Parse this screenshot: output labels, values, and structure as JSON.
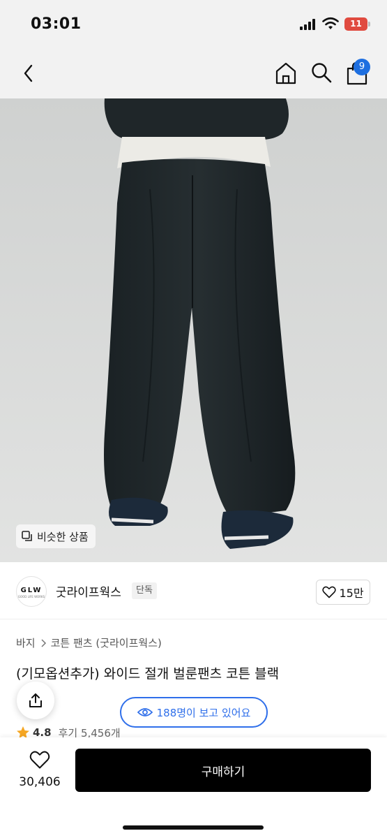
{
  "status_bar": {
    "time": "03:01",
    "battery": "11",
    "battery_color": "#e04a3f"
  },
  "nav": {
    "back_icon": "chevron-left-icon",
    "home_icon": "home-icon",
    "search_icon": "search-icon",
    "cart_icon": "shopping-bag-icon",
    "cart_count": "9",
    "badge_color": "#1e6fe0"
  },
  "hero": {
    "similar_label": "비슷한 상품"
  },
  "brand": {
    "logo_text": "GLW",
    "logo_subtext": "GOOD LIFE WORKS",
    "name": "굿라이프웍스",
    "exclusive_label": "단독",
    "like_count": "15만"
  },
  "breadcrumb": {
    "items": [
      "바지",
      "코튼 팬츠 (굿라이프웍스)"
    ]
  },
  "product": {
    "title": "(기모옵션추가) 와이드 절개 벌룬팬츠 코튼 블랙",
    "rating": "4.8",
    "reviews": "후기 5,456개",
    "viewers": "188명이 보고 있어요",
    "accent_color": "#2f6fea"
  },
  "bottom_bar": {
    "wish_count": "30,406",
    "buy_label": "구매하기"
  }
}
